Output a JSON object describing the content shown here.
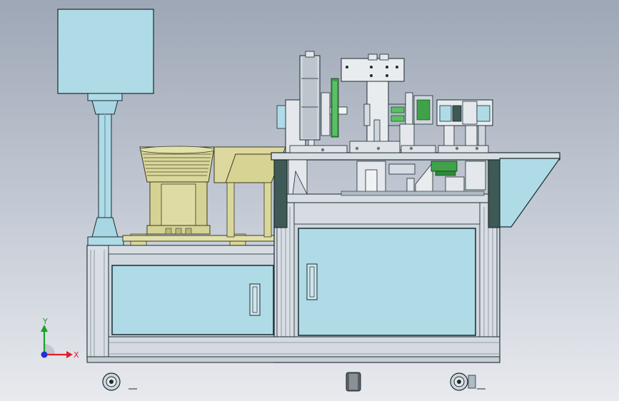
{
  "viewport": {
    "axes": {
      "x_label": "X",
      "y_label": "Y",
      "x_color": "#e0202a",
      "y_color": "#1aa02a",
      "z_color": "#2030d0"
    }
  },
  "colors": {
    "background_top": "#9ea7b6",
    "background_bottom": "#e8eaee",
    "frame": "#cfd6dd",
    "panel": "#aedbe6",
    "bowl": "#d9d79a",
    "dark_post": "#3f5a56",
    "green_part": "#3fa24a"
  }
}
